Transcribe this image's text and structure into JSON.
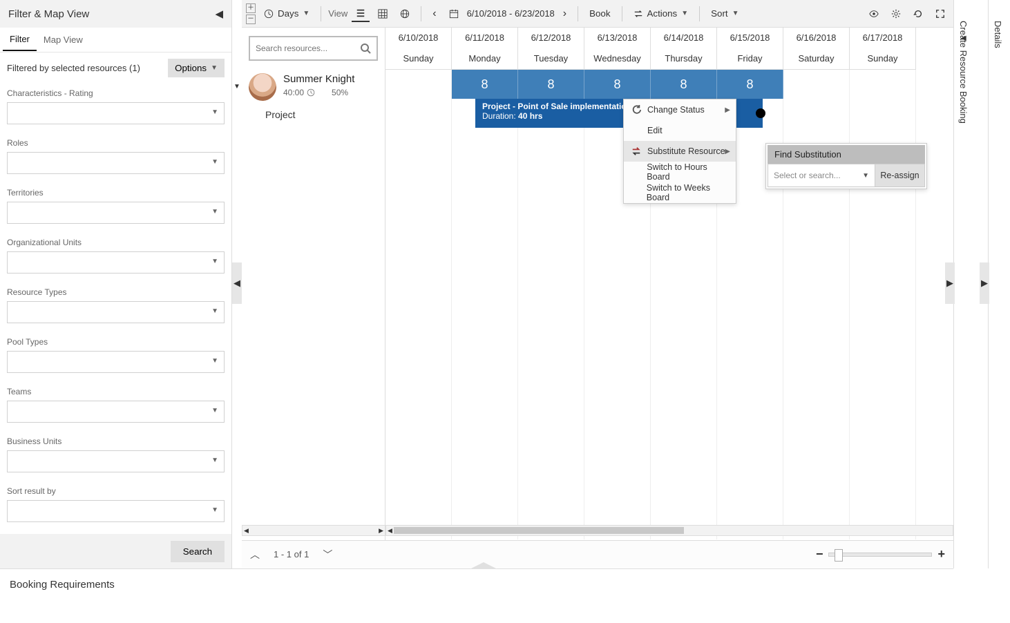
{
  "left": {
    "header_title": "Filter & Map View",
    "tabs": {
      "filter": "Filter",
      "map": "Map View"
    },
    "summary": "Filtered by selected resources (1)",
    "options": "Options",
    "filters": [
      "Characteristics - Rating",
      "Roles",
      "Territories",
      "Organizational Units",
      "Resource Types",
      "Pool Types",
      "Teams",
      "Business Units",
      "Sort result by"
    ],
    "search_btn": "Search"
  },
  "toolbar": {
    "days": "Days",
    "view": "View",
    "date_range": "6/10/2018 - 6/23/2018",
    "book": "Book",
    "actions": "Actions",
    "sort": "Sort"
  },
  "resource": {
    "search_placeholder": "Search resources...",
    "name": "Summer Knight",
    "hours": "40:00",
    "pct": "50%",
    "project_label": "Project"
  },
  "calendar": {
    "columns": [
      {
        "date": "6/10/2018",
        "dow": "Sunday"
      },
      {
        "date": "6/11/2018",
        "dow": "Monday"
      },
      {
        "date": "6/12/2018",
        "dow": "Tuesday"
      },
      {
        "date": "6/13/2018",
        "dow": "Wednesday"
      },
      {
        "date": "6/14/2018",
        "dow": "Thursday"
      },
      {
        "date": "6/15/2018",
        "dow": "Friday"
      },
      {
        "date": "6/16/2018",
        "dow": "Saturday"
      },
      {
        "date": "6/17/2018",
        "dow": "Sunday"
      }
    ],
    "allocation": [
      "8",
      "8",
      "8",
      "8",
      "8"
    ],
    "booking": {
      "title": "Project - Point of Sale implementation",
      "duration_label": "Duration: ",
      "duration_value": "40 hrs"
    }
  },
  "context_menu": {
    "change_status": "Change Status",
    "edit": "Edit",
    "substitute": "Substitute Resource",
    "switch_hours": "Switch to Hours Board",
    "switch_weeks": "Switch to Weeks Board"
  },
  "submenu": {
    "title": "Find Substitution",
    "select_placeholder": "Select or search...",
    "reassign": "Re-assign"
  },
  "sheet_footer": {
    "page_text": "1 - 1 of 1"
  },
  "right_rails": {
    "create_booking": "Create Resource Booking",
    "details": "Details"
  },
  "bottom": {
    "title": "Booking Requirements"
  }
}
